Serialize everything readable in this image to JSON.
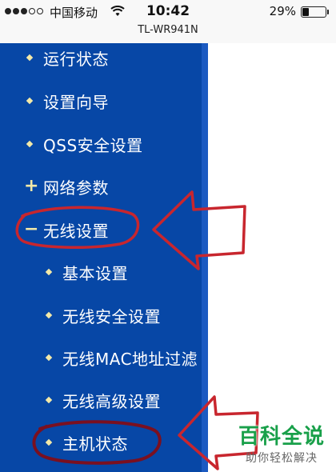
{
  "status_bar": {
    "carrier": "中国移动",
    "time": "10:42",
    "battery": "29%",
    "battery_level": 0.29,
    "signal_bars_filled": 3,
    "signal_bars_total": 5
  },
  "page": {
    "title": "TL-WR941N"
  },
  "nav": {
    "items": [
      {
        "label": "运行状态",
        "marker": "bullet"
      },
      {
        "label": "设置向导",
        "marker": "bullet"
      },
      {
        "label": "QSS安全设置",
        "marker": "bullet"
      },
      {
        "label": "网络参数",
        "marker": "plus"
      },
      {
        "label": "无线设置",
        "marker": "minus"
      }
    ],
    "subitems": [
      {
        "label": "基本设置"
      },
      {
        "label": "无线安全设置"
      },
      {
        "label": "无线MAC地址过滤"
      },
      {
        "label": "无线高级设置"
      },
      {
        "label": "主机状态"
      }
    ]
  },
  "colors": {
    "nav_bg": "#0747a6",
    "annotation": "#c8262e",
    "bullet": "#f3e9a8",
    "watermark": "#19a04a"
  },
  "watermark": {
    "title": "百科全说",
    "subtitle": "助你轻松解决"
  }
}
